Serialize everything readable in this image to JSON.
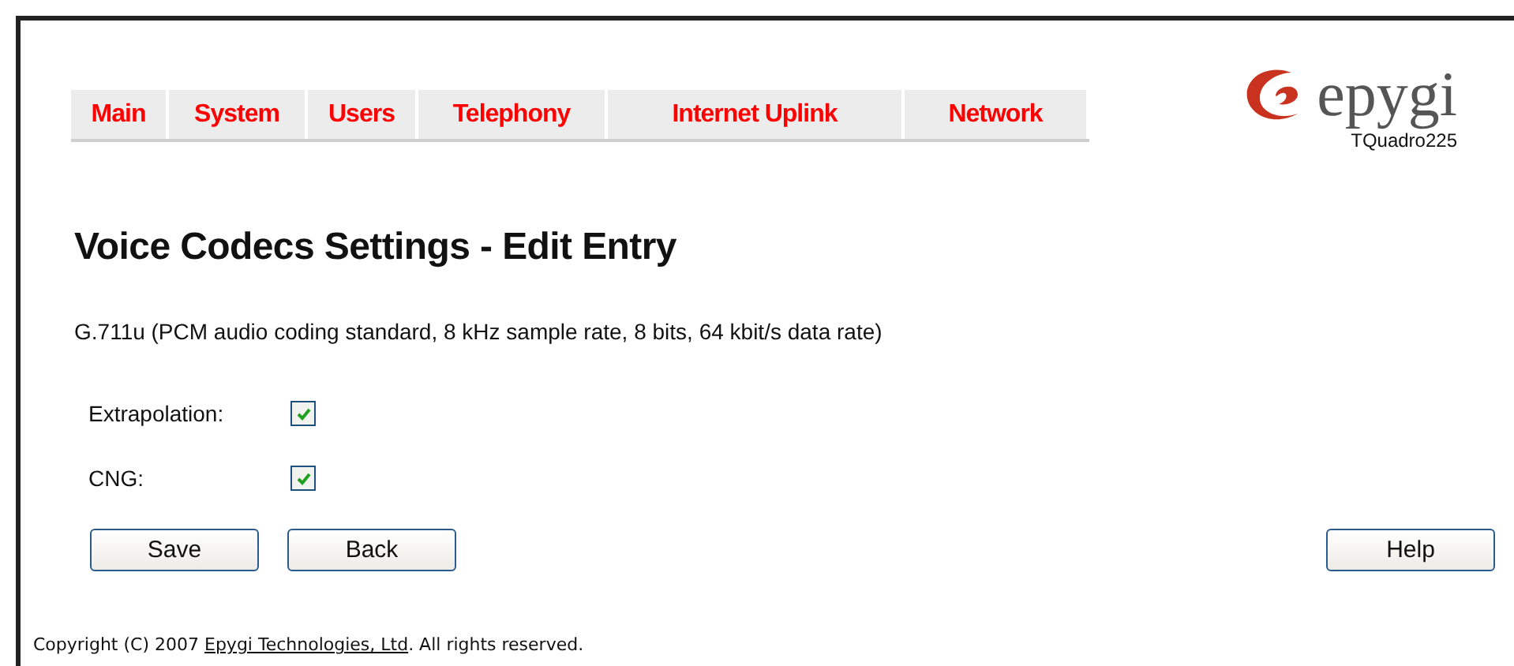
{
  "nav": [
    {
      "label": "Main"
    },
    {
      "label": "System"
    },
    {
      "label": "Users"
    },
    {
      "label": "Telephony"
    },
    {
      "label": "Internet Uplink"
    },
    {
      "label": "Network"
    }
  ],
  "logo": {
    "brand": "epygi",
    "model": "TQuadro225"
  },
  "title": "Voice Codecs Settings - Edit Entry",
  "description": "G.711u (PCM audio coding standard, 8 kHz sample rate, 8 bits, 64 kbit/s data rate)",
  "options": [
    {
      "label": "Extrapolation:",
      "checked": true
    },
    {
      "label": "CNG:",
      "checked": true
    }
  ],
  "buttons": [
    "Save",
    "Back"
  ],
  "help_button": "Help",
  "footer": {
    "before": "Copyright (C) 2007 ",
    "link": "Epygi Technologies, Ltd",
    "after": ". All rights reserved."
  }
}
